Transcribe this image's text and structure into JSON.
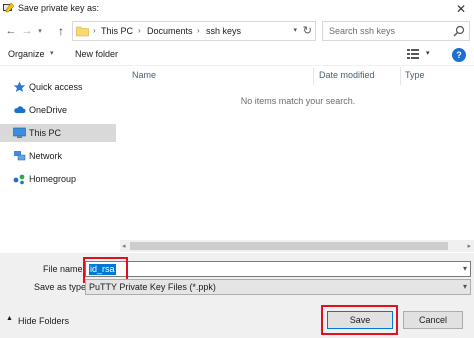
{
  "window": {
    "title": "Save private key as:",
    "close_glyph": "✕"
  },
  "address": {
    "crumbs": [
      "This PC",
      "Documents",
      "ssh keys"
    ],
    "separator": "›",
    "search_placeholder": "Search ssh keys"
  },
  "toolbar": {
    "organize_label": "Organize",
    "new_folder_label": "New folder",
    "help_glyph": "?"
  },
  "sidebar": {
    "items": [
      {
        "label": "Quick access",
        "icon": "star-icon"
      },
      {
        "label": "OneDrive",
        "icon": "cloud-icon"
      },
      {
        "label": "This PC",
        "icon": "computer-icon",
        "selected": true
      },
      {
        "label": "Network",
        "icon": "network-icon"
      },
      {
        "label": "Homegroup",
        "icon": "homegroup-icon"
      }
    ]
  },
  "filelist": {
    "columns": [
      "Name",
      "Date modified",
      "Type"
    ],
    "empty_message": "No items match your search."
  },
  "form": {
    "filename_label": "File name:",
    "filename_value": "id_rsa",
    "saveas_label": "Save as type:",
    "saveas_value": "PuTTY Private Key Files (*.ppk)"
  },
  "footer": {
    "hide_folders_label": "Hide Folders",
    "save_label": "Save",
    "cancel_label": "Cancel"
  },
  "colors": {
    "accent": "#0078d7",
    "highlight_box": "#e0101c",
    "selected_nav": "#d9d9d9"
  }
}
